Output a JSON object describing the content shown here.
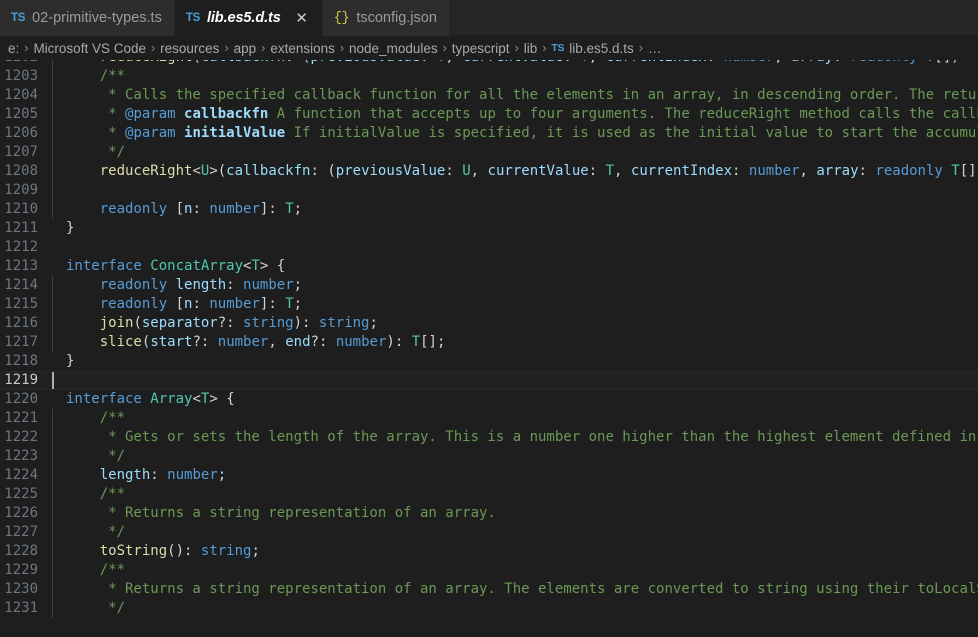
{
  "window": {
    "app": "Visual Studio Code",
    "theme_bg": "#1e1e1e",
    "accent": "#569cd6"
  },
  "tabs": [
    {
      "label": "02-primitive-types.ts",
      "icon": "typescript-file-icon",
      "icon_text": "TS",
      "active": false,
      "closable": false
    },
    {
      "label": "lib.es5.d.ts",
      "icon": "typescript-file-icon",
      "icon_text": "TS",
      "active": true,
      "closable": true,
      "close_label": "✕"
    },
    {
      "label": "tsconfig.json",
      "icon": "json-file-icon",
      "icon_text": "{}",
      "active": false,
      "closable": false
    }
  ],
  "breadcrumbs": {
    "separator": "›",
    "items": [
      {
        "label": "e:",
        "icon": null
      },
      {
        "label": "Microsoft VS Code",
        "icon": null
      },
      {
        "label": "resources",
        "icon": null
      },
      {
        "label": "app",
        "icon": null
      },
      {
        "label": "extensions",
        "icon": null
      },
      {
        "label": "node_modules",
        "icon": null
      },
      {
        "label": "typescript",
        "icon": null
      },
      {
        "label": "lib",
        "icon": null
      },
      {
        "label": "lib.es5.d.ts",
        "icon": "typescript-file-icon",
        "icon_text": "TS"
      },
      {
        "label": "…",
        "icon": null
      }
    ]
  },
  "editor": {
    "file": "lib.es5.d.ts",
    "language": "typescript",
    "cursor_line": 1219,
    "cursor_column": 1,
    "first_visible_line": 1202,
    "last_visible_line": 1231,
    "lines": [
      {
        "n": 1202,
        "indent": 1,
        "text": "    reduceRight(callbackfn: (previousValue: T, currentValue: T, currentIndex: number, array: readonly T[]) => T, initia"
      },
      {
        "n": 1203,
        "indent": 1,
        "text": "    /**"
      },
      {
        "n": 1204,
        "indent": 1,
        "text": "     * Calls the specified callback function for all the elements in an array, in descending order. The return value of"
      },
      {
        "n": 1205,
        "indent": 1,
        "text": "     * @param callbackfn A function that accepts up to four arguments. The reduceRight method calls the callbackfn func"
      },
      {
        "n": 1206,
        "indent": 1,
        "text": "     * @param initialValue If initialValue is specified, it is used as the initial value to start the accumulation. The"
      },
      {
        "n": 1207,
        "indent": 1,
        "text": "     */"
      },
      {
        "n": 1208,
        "indent": 1,
        "text": "    reduceRight<U>(callbackfn: (previousValue: U, currentValue: T, currentIndex: number, array: readonly T[]) => U, ini"
      },
      {
        "n": 1209,
        "indent": 1,
        "text": ""
      },
      {
        "n": 1210,
        "indent": 1,
        "text": "    readonly [n: number]: T;"
      },
      {
        "n": 1211,
        "indent": 0,
        "text": "}"
      },
      {
        "n": 1212,
        "indent": 0,
        "text": ""
      },
      {
        "n": 1213,
        "indent": 0,
        "text": "interface ConcatArray<T> {"
      },
      {
        "n": 1214,
        "indent": 1,
        "text": "    readonly length: number;"
      },
      {
        "n": 1215,
        "indent": 1,
        "text": "    readonly [n: number]: T;"
      },
      {
        "n": 1216,
        "indent": 1,
        "text": "    join(separator?: string): string;"
      },
      {
        "n": 1217,
        "indent": 1,
        "text": "    slice(start?: number, end?: number): T[];"
      },
      {
        "n": 1218,
        "indent": 0,
        "text": "}"
      },
      {
        "n": 1219,
        "indent": 0,
        "text": ""
      },
      {
        "n": 1220,
        "indent": 0,
        "text": "interface Array<T> {"
      },
      {
        "n": 1221,
        "indent": 1,
        "text": "    /**"
      },
      {
        "n": 1222,
        "indent": 1,
        "text": "     * Gets or sets the length of the array. This is a number one higher than the highest element defined in an array."
      },
      {
        "n": 1223,
        "indent": 1,
        "text": "     */"
      },
      {
        "n": 1224,
        "indent": 1,
        "text": "    length: number;"
      },
      {
        "n": 1225,
        "indent": 1,
        "text": "    /**"
      },
      {
        "n": 1226,
        "indent": 1,
        "text": "     * Returns a string representation of an array."
      },
      {
        "n": 1227,
        "indent": 1,
        "text": "     */"
      },
      {
        "n": 1228,
        "indent": 1,
        "text": "    toString(): string;"
      },
      {
        "n": 1229,
        "indent": 1,
        "text": "    /**"
      },
      {
        "n": 1230,
        "indent": 1,
        "text": "     * Returns a string representation of an array. The elements are converted to string using their toLocalString meth"
      },
      {
        "n": 1231,
        "indent": 1,
        "text": "     */"
      }
    ]
  }
}
